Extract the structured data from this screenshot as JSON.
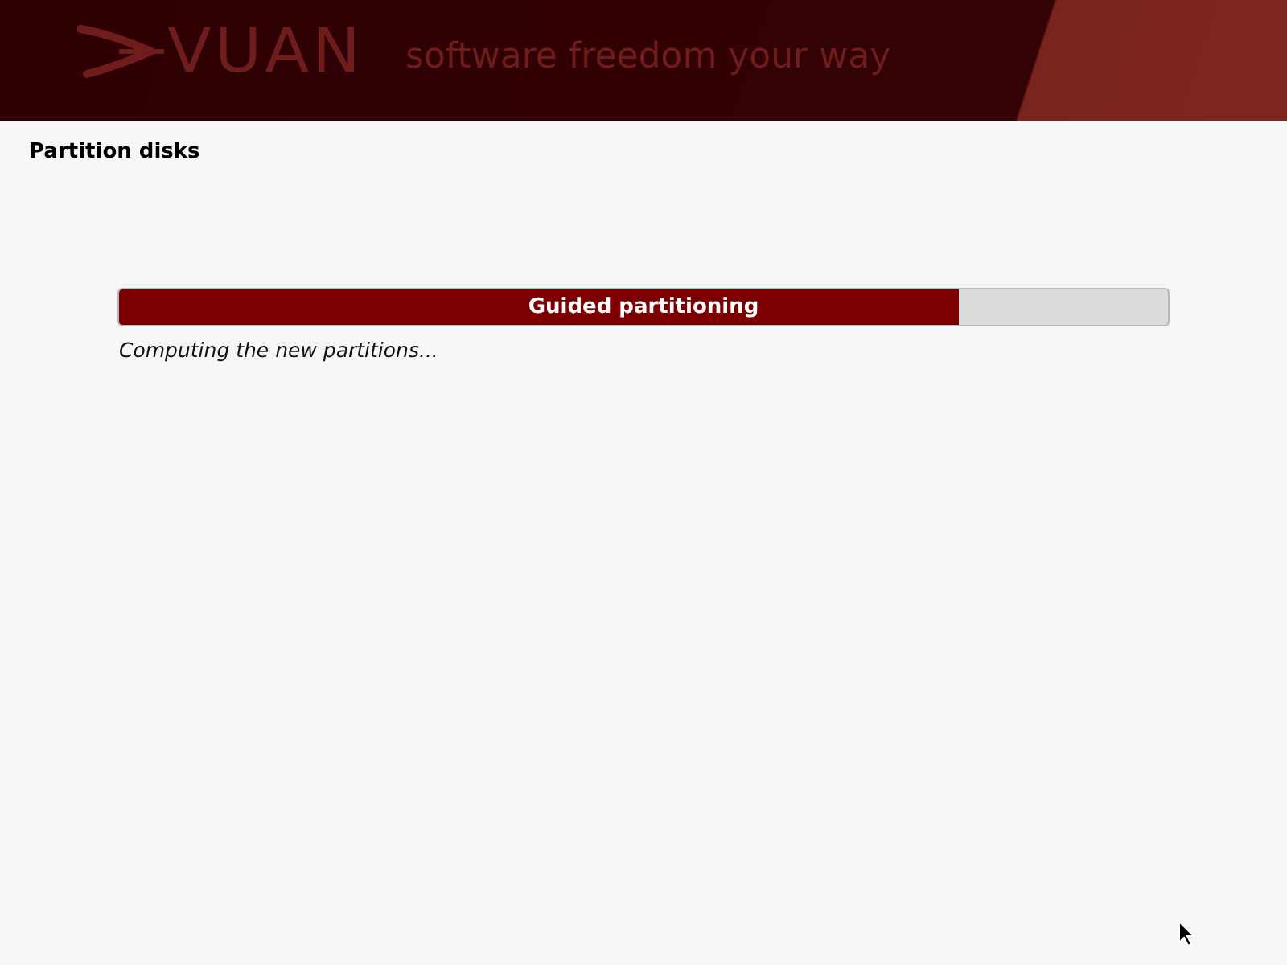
{
  "header": {
    "logo": "VUAN",
    "tagline": "software freedom your way"
  },
  "title": "Partition disks",
  "progress": {
    "label": "Guided partitioning",
    "level": 0.8,
    "status": "Computing the new partitions..."
  }
}
